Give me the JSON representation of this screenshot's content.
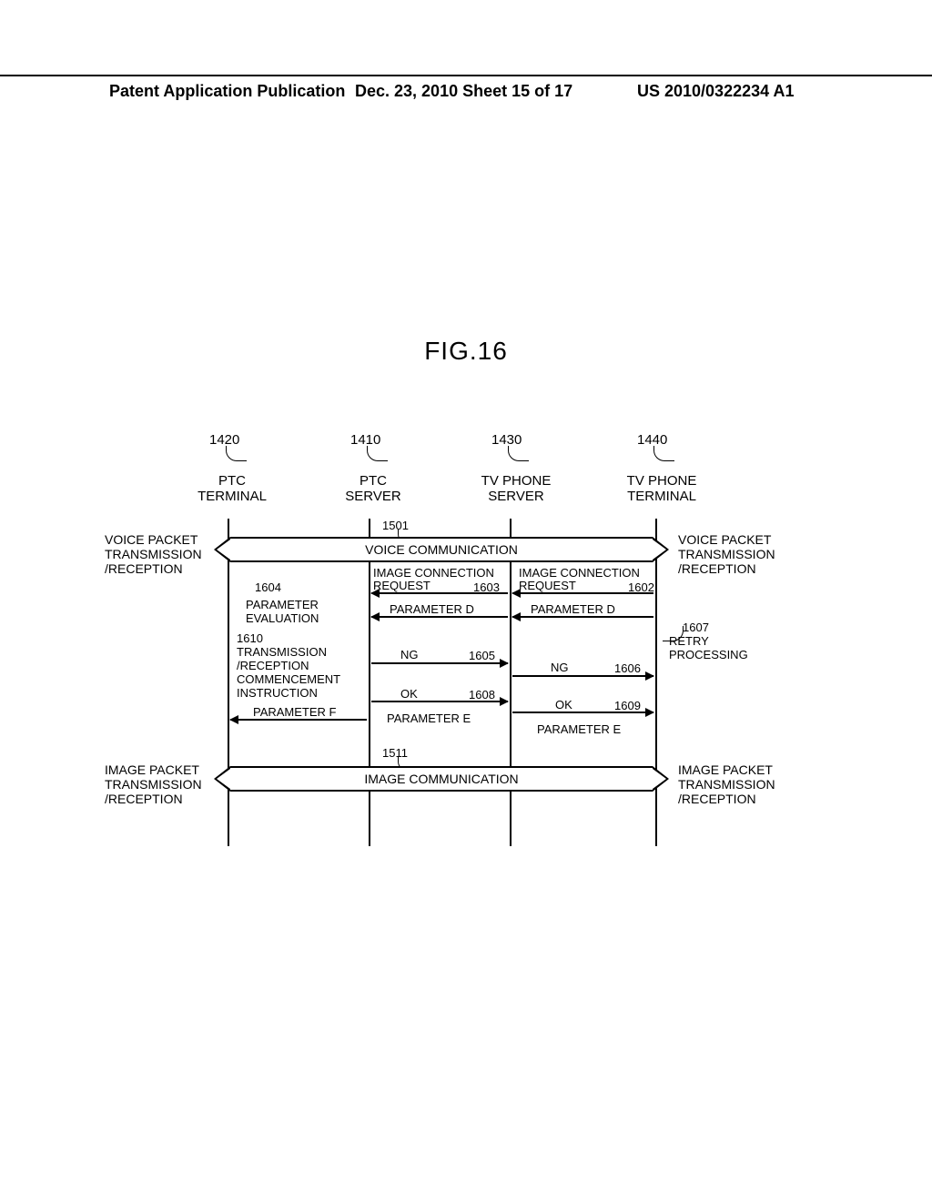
{
  "header": {
    "left": "Patent Application Publication",
    "mid": "Dec. 23, 2010  Sheet 15 of 17",
    "right": "US 2010/0322234 A1"
  },
  "figure_title": "FIG.16",
  "actors": {
    "a1": {
      "ref": "1420",
      "label": "PTC\nTERMINAL"
    },
    "a2": {
      "ref": "1410",
      "label": "PTC\nSERVER"
    },
    "a3": {
      "ref": "1430",
      "label": "TV PHONE\nSERVER"
    },
    "a4": {
      "ref": "1440",
      "label": "TV PHONE\nTERMINAL"
    }
  },
  "wide": {
    "voice": {
      "ref": "1501",
      "label": "VOICE COMMUNICATION"
    },
    "image": {
      "ref": "1511",
      "label": "IMAGE COMMUNICATION"
    }
  },
  "side": {
    "left_voice": "VOICE PACKET\nTRANSMISSION\n/RECEPTION",
    "right_voice": "VOICE PACKET\nTRANSMISSION\n/RECEPTION",
    "left_image": "IMAGE PACKET\nTRANSMISSION\n/RECEPTION",
    "right_image": "IMAGE PACKET\nTRANSMISSION\n/RECEPTION"
  },
  "msgs": {
    "m1602": {
      "label": "IMAGE CONNECTION\nREQUEST",
      "ref": "1602"
    },
    "m1603": {
      "label": "IMAGE CONNECTION\nREQUEST",
      "ref": "1603"
    },
    "m_pd_a": {
      "label": "PARAMETER D"
    },
    "m_pd_b": {
      "label": "PARAMETER D"
    },
    "m1605": {
      "label": "NG",
      "ref": "1605"
    },
    "m1606": {
      "label": "NG",
      "ref": "1606"
    },
    "m1608": {
      "label": "OK",
      "ref": "1608"
    },
    "m1609": {
      "label": "OK",
      "ref": "1609"
    },
    "m_pe_a": {
      "label": "PARAMETER E"
    },
    "m_pe_b": {
      "label": "PARAMETER E"
    },
    "m_pf": {
      "label": "PARAMETER F"
    }
  },
  "ann": {
    "a1604": {
      "ref": "1604",
      "text": "PARAMETER\nEVALUATION"
    },
    "a1610": {
      "ref": "1610",
      "text": "TRANSMISSION\n/RECEPTION\nCOMMENCEMENT\nINSTRUCTION"
    },
    "a1607": {
      "ref": "1607",
      "text": "RETRY\nPROCESSING"
    }
  }
}
